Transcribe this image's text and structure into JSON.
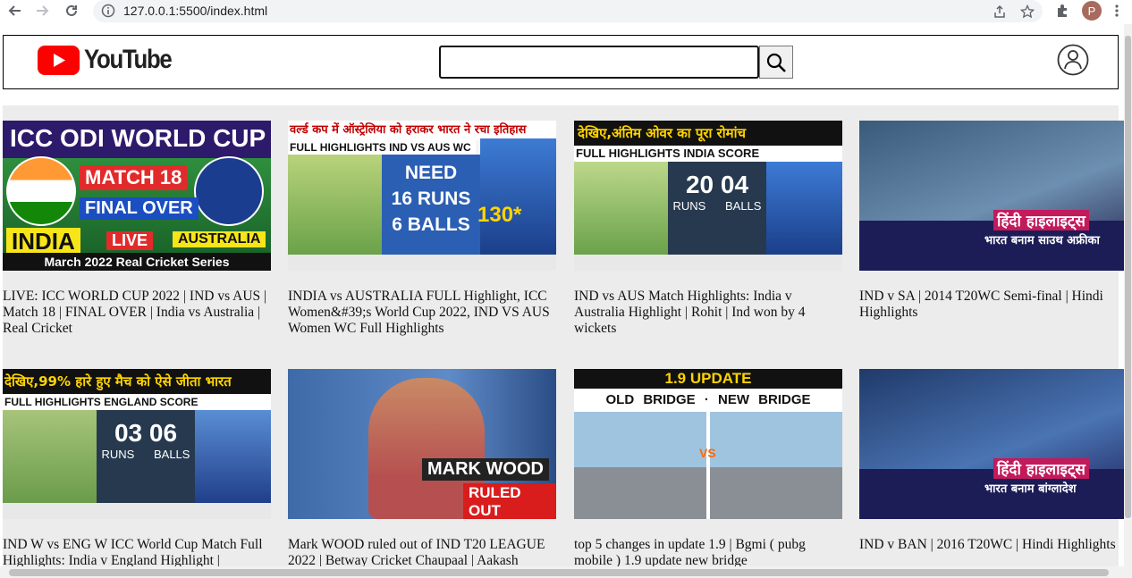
{
  "browser": {
    "url": "127.0.0.1:5500/index.html",
    "profile_initial": "P"
  },
  "header": {
    "logo_text": "YouTube",
    "search": {
      "value": "",
      "placeholder": ""
    }
  },
  "videos": [
    {
      "title": "LIVE: ICC WORLD CUP 2022 | IND vs AUS | Match 18 | FINAL OVER | India vs Australia | Real Cricket",
      "thumb": {
        "t1": "ICC ODI WORLD CUP",
        "t2": "MATCH 18",
        "t3": "FINAL OVER",
        "t4": "INDIA",
        "t5": "LIVE",
        "t6": "AUSTRALIA",
        "t7": "March 2022 Real Cricket Series"
      }
    },
    {
      "title": "INDIA vs AUSTRALIA FULL Highlight, ICC Women&#39;s World Cup 2022, IND VS AUS Women WC Full Highlights",
      "thumb": {
        "t1": "वर्ल्ड कप में ऑस्ट्रेलिया को हराकर भारत ने रचा इतिहास",
        "t2": "FULL HIGHLIGHTS IND VS AUS WC",
        "t3": "NEED",
        "t4": "16 RUNS",
        "t5": "6 BALLS",
        "t6": "130*"
      }
    },
    {
      "title": "IND vs AUS Match Highlights: India v Australia Highlight | Rohit | Ind won by 4 wickets",
      "thumb": {
        "t1": "देखिए,अंतिम ओवर का पूरा रोमांच",
        "t2": "FULL HIGHLIGHTS INDIA SCORE",
        "t3": "20",
        "t4": "04",
        "t5": "RUNS",
        "t6": "BALLS"
      }
    },
    {
      "title": "IND v SA | 2014 T20WC Semi-final | Hindi Highlights",
      "thumb": {
        "t1": "हिंदी हाइलाइट्स",
        "t2": "भारत बनाम साउथ अफ्रीका"
      }
    },
    {
      "title": "IND W vs ENG W ICC World Cup Match Full Highlights: India v England Highlight |",
      "thumb": {
        "t1": "देखिए,99% हारे हुए मैच को ऐसे जीता भारत",
        "t2": "FULL HIGHLIGHTS ENGLAND SCORE",
        "t3": "03",
        "t4": "06",
        "t5": "RUNS",
        "t6": "BALLS"
      }
    },
    {
      "title": "Mark WOOD ruled out of IND T20 LEAGUE 2022 | Betway Cricket Chaupaal | Aakash",
      "thumb": {
        "t1": "MARK WOOD",
        "t2": "RULED OUT"
      }
    },
    {
      "title": "top 5 changes in update 1.9 | Bgmi ( pubg mobile ) 1.9 update new bridge",
      "thumb": {
        "t1": "1.9 UPDATE",
        "t2": "OLD BRIDGE · NEW BRIDGE",
        "t3": "VS"
      }
    },
    {
      "title": "IND v BAN | 2016 T20WC | Hindi Highlights",
      "thumb": {
        "t1": "हिंदी हाइलाइट्स",
        "t2": "भारत बनाम बांग्लादेश"
      }
    }
  ]
}
